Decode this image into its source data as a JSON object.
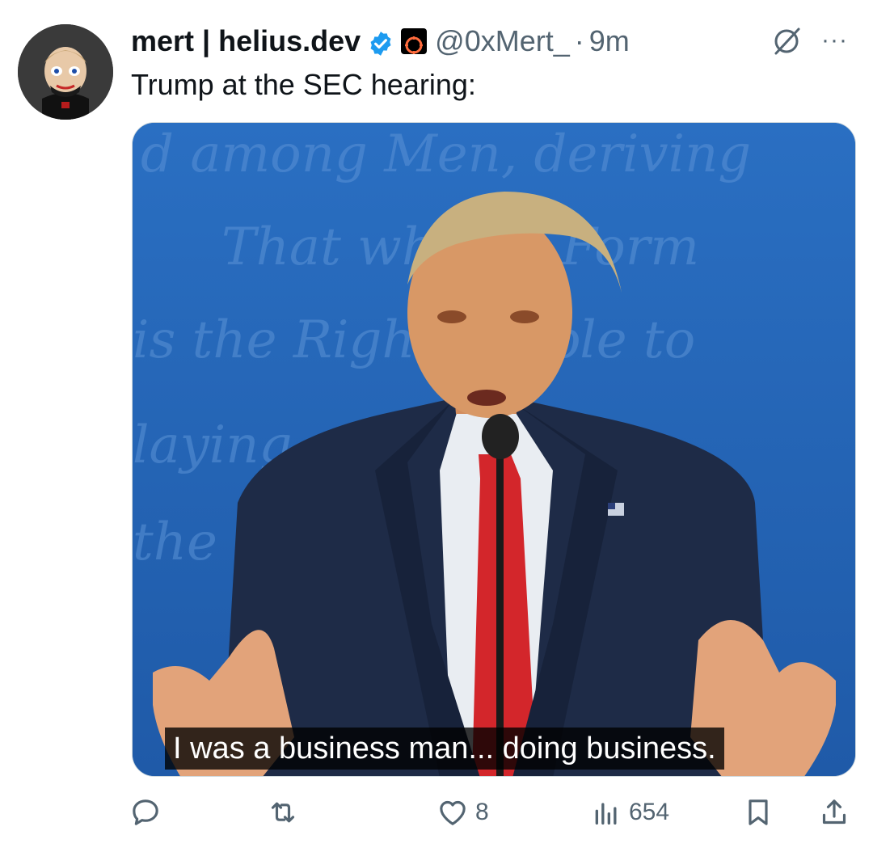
{
  "tweet": {
    "author_name": "mert | helius.dev",
    "handle": "@0xMert_",
    "separator": "·",
    "time": "9m",
    "text": "Trump at the SEC hearing:",
    "more_label": "···"
  },
  "media": {
    "caption": "I was a business man... doing business.",
    "background_script_lines": [
      "d among Men, deriving",
      "That wh     any Form",
      "is the Right     People to",
      "laying     such",
      "the     likely"
    ]
  },
  "actions": {
    "reply": {
      "icon": "reply-icon",
      "count": ""
    },
    "retweet": {
      "icon": "retweet-icon",
      "count": ""
    },
    "like": {
      "icon": "heart-icon",
      "count": "8"
    },
    "views": {
      "icon": "views-icon",
      "count": "654"
    },
    "bookmark": {
      "icon": "bookmark-icon"
    },
    "share": {
      "icon": "share-icon"
    }
  },
  "colors": {
    "text": "#0f1419",
    "muted": "#536471",
    "verified": "#1d9bf0",
    "media_bg": "#2467b9"
  }
}
